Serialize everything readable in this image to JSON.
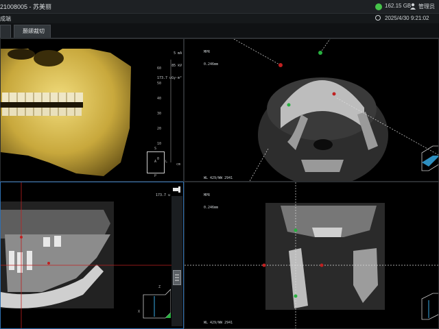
{
  "window": {
    "title": "21008005 - 苏美丽",
    "disk_free": "162.15 GB",
    "user": "管理员",
    "sub_label": "成端",
    "datetime": "2025/4/30 9:21:02"
  },
  "tabs": [
    {
      "label": ""
    },
    {
      "label": "颞颌裁切"
    }
  ],
  "views": {
    "volume": {
      "info_lines": [
        "5 mA",
        "85 kV",
        "173.7 uGy·m²"
      ],
      "ruler_ticks": [
        "60",
        "50",
        "40",
        "30",
        "20",
        "10",
        "0"
      ],
      "ruler_unit": "cm",
      "orientation": {
        "top": "S",
        "center": "A",
        "bottom": "P",
        "right": "L"
      }
    },
    "axial": {
      "mpr_label": "MPR",
      "slice": "0.246mm",
      "wl": "WL 429/WW 2941"
    },
    "sagittal": {
      "info": "173.7 u",
      "axis_label": "Z",
      "x_label": "X"
    },
    "coronal": {
      "mpr_label": "MPR",
      "slice": "0.246mm",
      "wl": "WL 429/WW 2941"
    }
  },
  "icons": {
    "disk": "disk-icon",
    "user": "user-icon",
    "clock": "clock-icon",
    "pin": "pin-icon",
    "menu": "menu-icon"
  },
  "colors": {
    "disk_status": "#46c44a",
    "active_border": "#2e6fb0",
    "crosshair": "#c02020",
    "bone": "#d8c060"
  }
}
